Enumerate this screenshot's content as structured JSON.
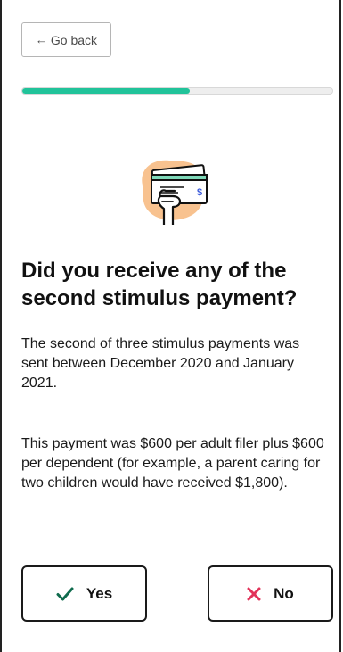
{
  "nav": {
    "back_label": "Go back",
    "back_icon": "arrow-left-icon"
  },
  "progress": {
    "fraction": 0.54,
    "color": "#21c39a"
  },
  "illustration": {
    "icon": "hand-holding-check-icon"
  },
  "question": {
    "title": "Did you receive any of the second stimulus payment?",
    "paragraph_1": "The second of three stimulus payments was sent between December 2020 and January 2021.",
    "paragraph_2": "This payment was $600 per adult filer plus $600 per dependent (for example, a parent caring for two children would have received $1,800)."
  },
  "answers": {
    "yes_label": "Yes",
    "yes_icon": "checkmark-icon",
    "yes_color": "#0f6b4d",
    "no_label": "No",
    "no_icon": "x-icon",
    "no_color": "#e2335a"
  }
}
